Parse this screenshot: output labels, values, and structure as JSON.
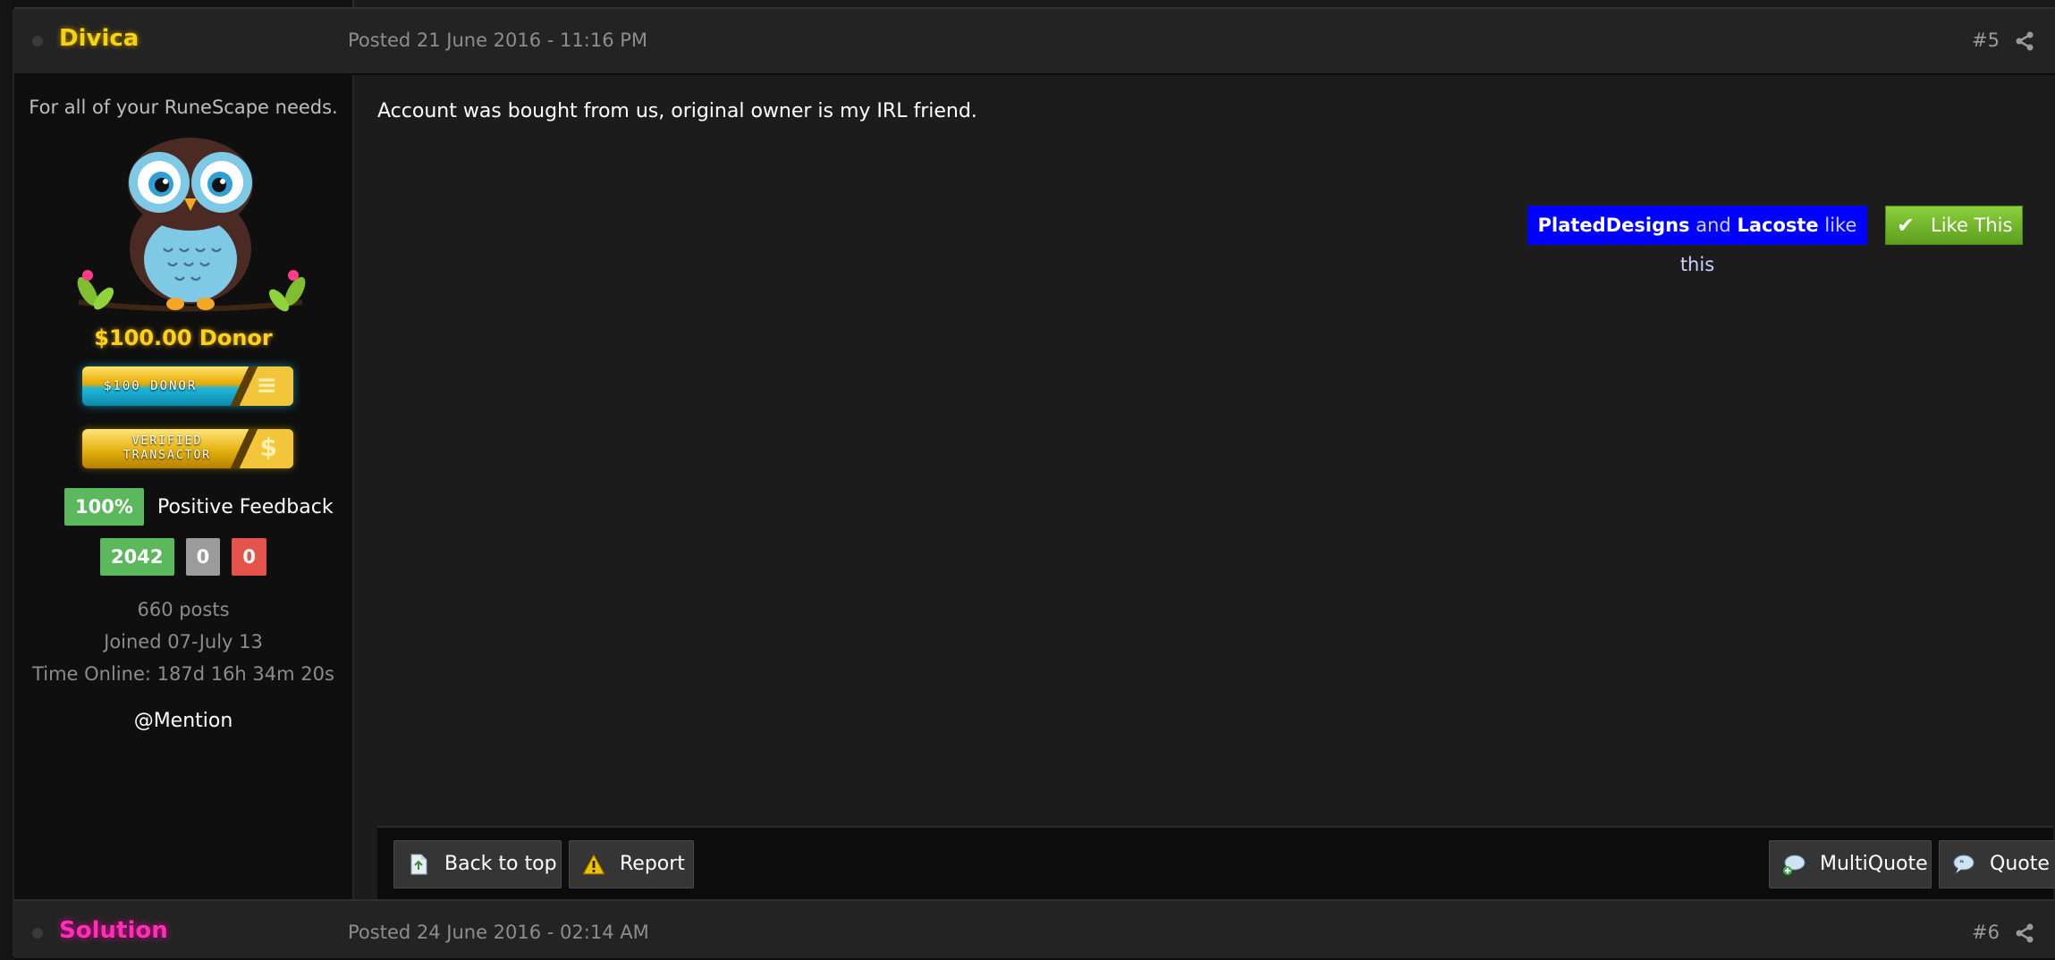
{
  "posts": [
    {
      "username": "Divica",
      "posted": "Posted 21 June 2016 - 11:16 PM",
      "post_number": "#5"
    },
    {
      "username": "Solution",
      "posted": "Posted 24 June 2016 - 02:14 AM",
      "post_number": "#6"
    }
  ],
  "author": {
    "title": "For all of your RuneScape needs.",
    "avatar_icon": "owl-icon",
    "donor_text": "$100.00 Donor",
    "badge_donor": "$100 DONOR",
    "badge_verified": "VERIFIED TRANSACTOR",
    "feedback_percent": "100%",
    "feedback_label": "Positive Feedback",
    "feedback_positive": "2042",
    "feedback_neutral": "0",
    "feedback_negative": "0",
    "posts": "660 posts",
    "joined": "Joined 07-July 13",
    "time_online": "Time Online: 187d 16h 34m 20s",
    "mention": "@Mention"
  },
  "content": {
    "text": "Account was bought from us, original owner is my IRL friend.",
    "likes": {
      "user1": "PlatedDesigns",
      "joiner": "and",
      "user2": "Lacoste",
      "suffix": "like this"
    },
    "like_button": "Like This"
  },
  "footer": {
    "back_to_top": "Back to top",
    "report": "Report",
    "multiquote": "MultiQuote",
    "quote": "Quote"
  },
  "colors": {
    "divica": "#f5d30f",
    "solution": "#ff2fb8",
    "likes_bg": "#0000ff",
    "like_green": "#6cb52a",
    "feedback_green": "#5cb85c",
    "feedback_red": "#e4544b"
  }
}
